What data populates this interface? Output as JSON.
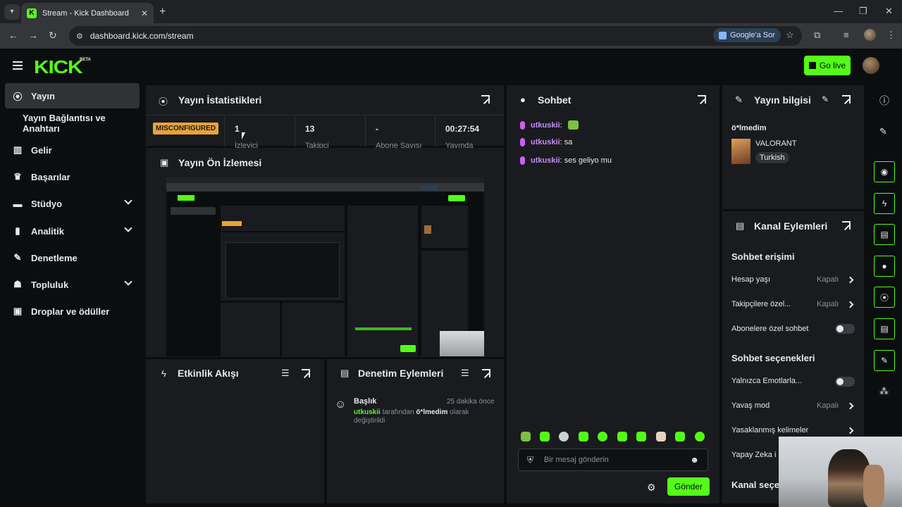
{
  "browser": {
    "tab_title": "Stream - Kick Dashboard",
    "url": "dashboard.kick.com/stream",
    "google_ask": "Google'a Sor"
  },
  "header": {
    "logo": "KICK",
    "beta": "BETA",
    "go_live": "Go live"
  },
  "sidebar": {
    "items": [
      {
        "label": "Yayın",
        "icon": "broadcast-icon"
      },
      {
        "label": "Yayın Bağlantısı ve Anahtarı",
        "icon": ""
      },
      {
        "label": "Gelir",
        "icon": "bank-icon"
      },
      {
        "label": "Başarılar",
        "icon": "trophy-icon"
      },
      {
        "label": "Stüdyo",
        "icon": "studio-icon"
      },
      {
        "label": "Analitik",
        "icon": "analytics-icon"
      },
      {
        "label": "Denetleme",
        "icon": "wrench-icon"
      },
      {
        "label": "Topluluk",
        "icon": "community-icon"
      },
      {
        "label": "Droplar ve ödüller",
        "icon": "gift-icon"
      }
    ]
  },
  "stats": {
    "title": "Yayın İstatistikleri",
    "status_badge": "MISCONFIGURED",
    "viewers_value": "1",
    "viewers_label": "İzleyici",
    "followers_value": "13",
    "followers_label": "Takipçi",
    "subs_value": "-",
    "subs_label": "Abone Sayısı",
    "uptime_value": "00:27:54",
    "uptime_label": "Yayında"
  },
  "preview": {
    "title": "Yayın Ön İzlemesi"
  },
  "activity": {
    "title": "Etkinlik Akışı"
  },
  "moderation": {
    "title": "Denetim Eylemleri",
    "entry_title": "Başlık",
    "entry_time": "25 dakika önce",
    "entry_user": "utkuskii",
    "entry_text1": " tarafından ",
    "entry_target": "ö*lmedim",
    "entry_text2": " olarak",
    "entry_text3": "değiştirildi"
  },
  "chat": {
    "title": "Sohbet",
    "messages": [
      {
        "user": "utkuskii",
        "text": ""
      },
      {
        "user": "utkuskii",
        "text": "sa"
      },
      {
        "user": "utkuskii",
        "text": "ses geliyo mu"
      }
    ],
    "input_placeholder": "Bir mesaj gönderin",
    "send_label": "Gönder"
  },
  "stream_info": {
    "title": "Yayın bilgisi",
    "stream_title": "ö*lmedim",
    "category": "VALORANT",
    "language": "Turkish"
  },
  "channel_actions": {
    "title": "Kanal Eylemleri",
    "chat_access_heading": "Sohbet erişimi",
    "account_age": "Hesap yaşı",
    "account_age_value": "Kapalı",
    "followers_only": "Takipçilere özel...",
    "followers_only_value": "Kapalı",
    "subs_only": "Abonelere özel sohbet",
    "chat_options_heading": "Sohbet seçenekleri",
    "emotes_only": "Yalnızca Emotlarla...",
    "slow_mode": "Yavaş mod",
    "slow_mode_value": "Kapalı",
    "banned_words": "Yasaklanmış kelimeler",
    "ai_mod": "Yapay Zeka i",
    "next_heading": "Kanal seçe"
  }
}
